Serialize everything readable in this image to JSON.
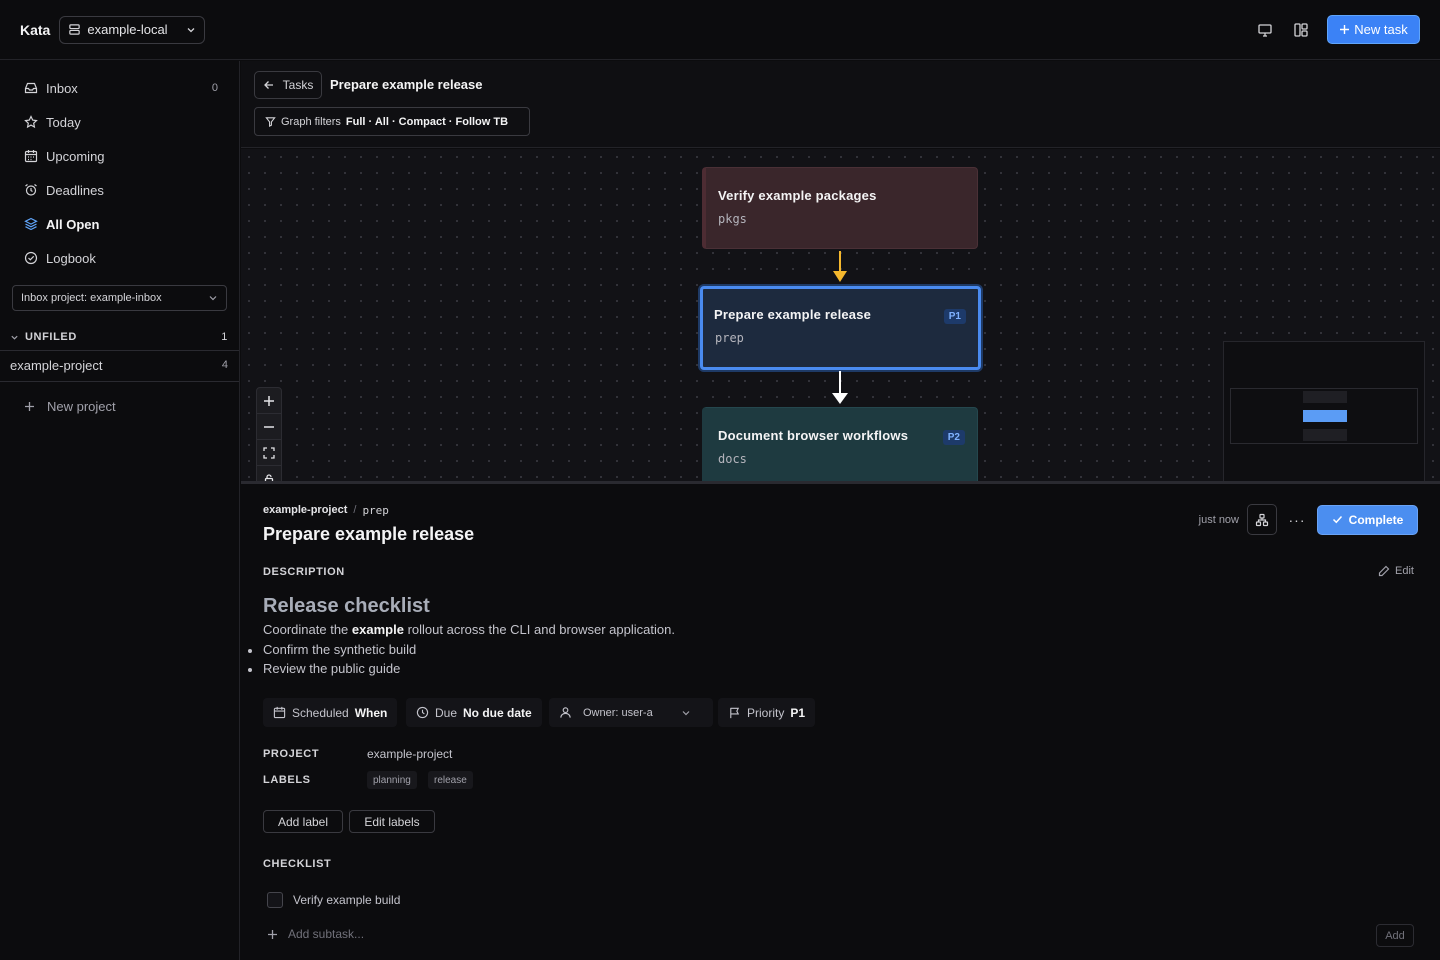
{
  "header": {
    "brand": "Kata",
    "workspace": "example-local",
    "new_task_label": "New task",
    "icons": [
      "monitor-icon",
      "layout-icon",
      "plus-icon",
      "database-icon",
      "chevron-down-icon"
    ],
    "accent_color": "#3b82f6"
  },
  "sidebar": {
    "items": [
      {
        "label": "Inbox",
        "icon": "inbox-icon",
        "count": "0"
      },
      {
        "label": "Today",
        "icon": "star-icon",
        "count": ""
      },
      {
        "label": "Upcoming",
        "icon": "calendar-icon",
        "count": ""
      },
      {
        "label": "Deadlines",
        "icon": "alarm-icon",
        "count": ""
      },
      {
        "label": "All Open",
        "icon": "layers-icon",
        "count": "",
        "active": true
      },
      {
        "label": "Logbook",
        "icon": "check-circle-icon",
        "count": ""
      }
    ],
    "inbox_project": "Inbox project: example-inbox",
    "unfiled": {
      "label": "UNFILED",
      "count": "1"
    },
    "projects": [
      {
        "label": "example-project",
        "count": "4"
      }
    ],
    "new_project_label": "New project"
  },
  "graph": {
    "back_label": "Tasks",
    "title": "Prepare example release",
    "filters_label": "Graph filters",
    "filters_value": "Full · All · Compact · Follow TB",
    "nodes": [
      {
        "title": "Verify example packages",
        "slug": "pkgs",
        "priority": ""
      },
      {
        "title": "Prepare example release",
        "slug": "prep",
        "priority": "P1"
      },
      {
        "title": "Document browser workflows",
        "slug": "docs",
        "priority": "P2"
      }
    ],
    "edge_colors": [
      "#f5b82e",
      "#ffffff"
    ]
  },
  "detail": {
    "project": "example-project",
    "slug": "prep",
    "title": "Prepare example release",
    "updated": "just now",
    "complete_label": "Complete",
    "description_label": "DESCRIPTION",
    "edit_label": "Edit",
    "description": {
      "heading": "Release checklist",
      "para_pre": "Coordinate the ",
      "para_bold": "example",
      "para_post": " rollout across the CLI and browser application.",
      "bullets": [
        "Confirm the synthetic build",
        "Review the public guide"
      ]
    },
    "chips": {
      "scheduled_label": "Scheduled",
      "scheduled_value": "When",
      "due_label": "Due",
      "due_value": "No due date",
      "owner": "Owner: user-a",
      "priority_label": "Priority",
      "priority_value": "P1"
    },
    "project_label": "PROJECT",
    "project_value": "example-project",
    "labels_label": "LABELS",
    "labels": [
      "planning",
      "release"
    ],
    "add_label": "Add label",
    "edit_labels": "Edit labels",
    "checklist_label": "CHECKLIST",
    "checklist": [
      {
        "text": "Verify example build",
        "done": false
      }
    ],
    "add_subtask_placeholder": "Add subtask...",
    "add_button": "Add"
  }
}
